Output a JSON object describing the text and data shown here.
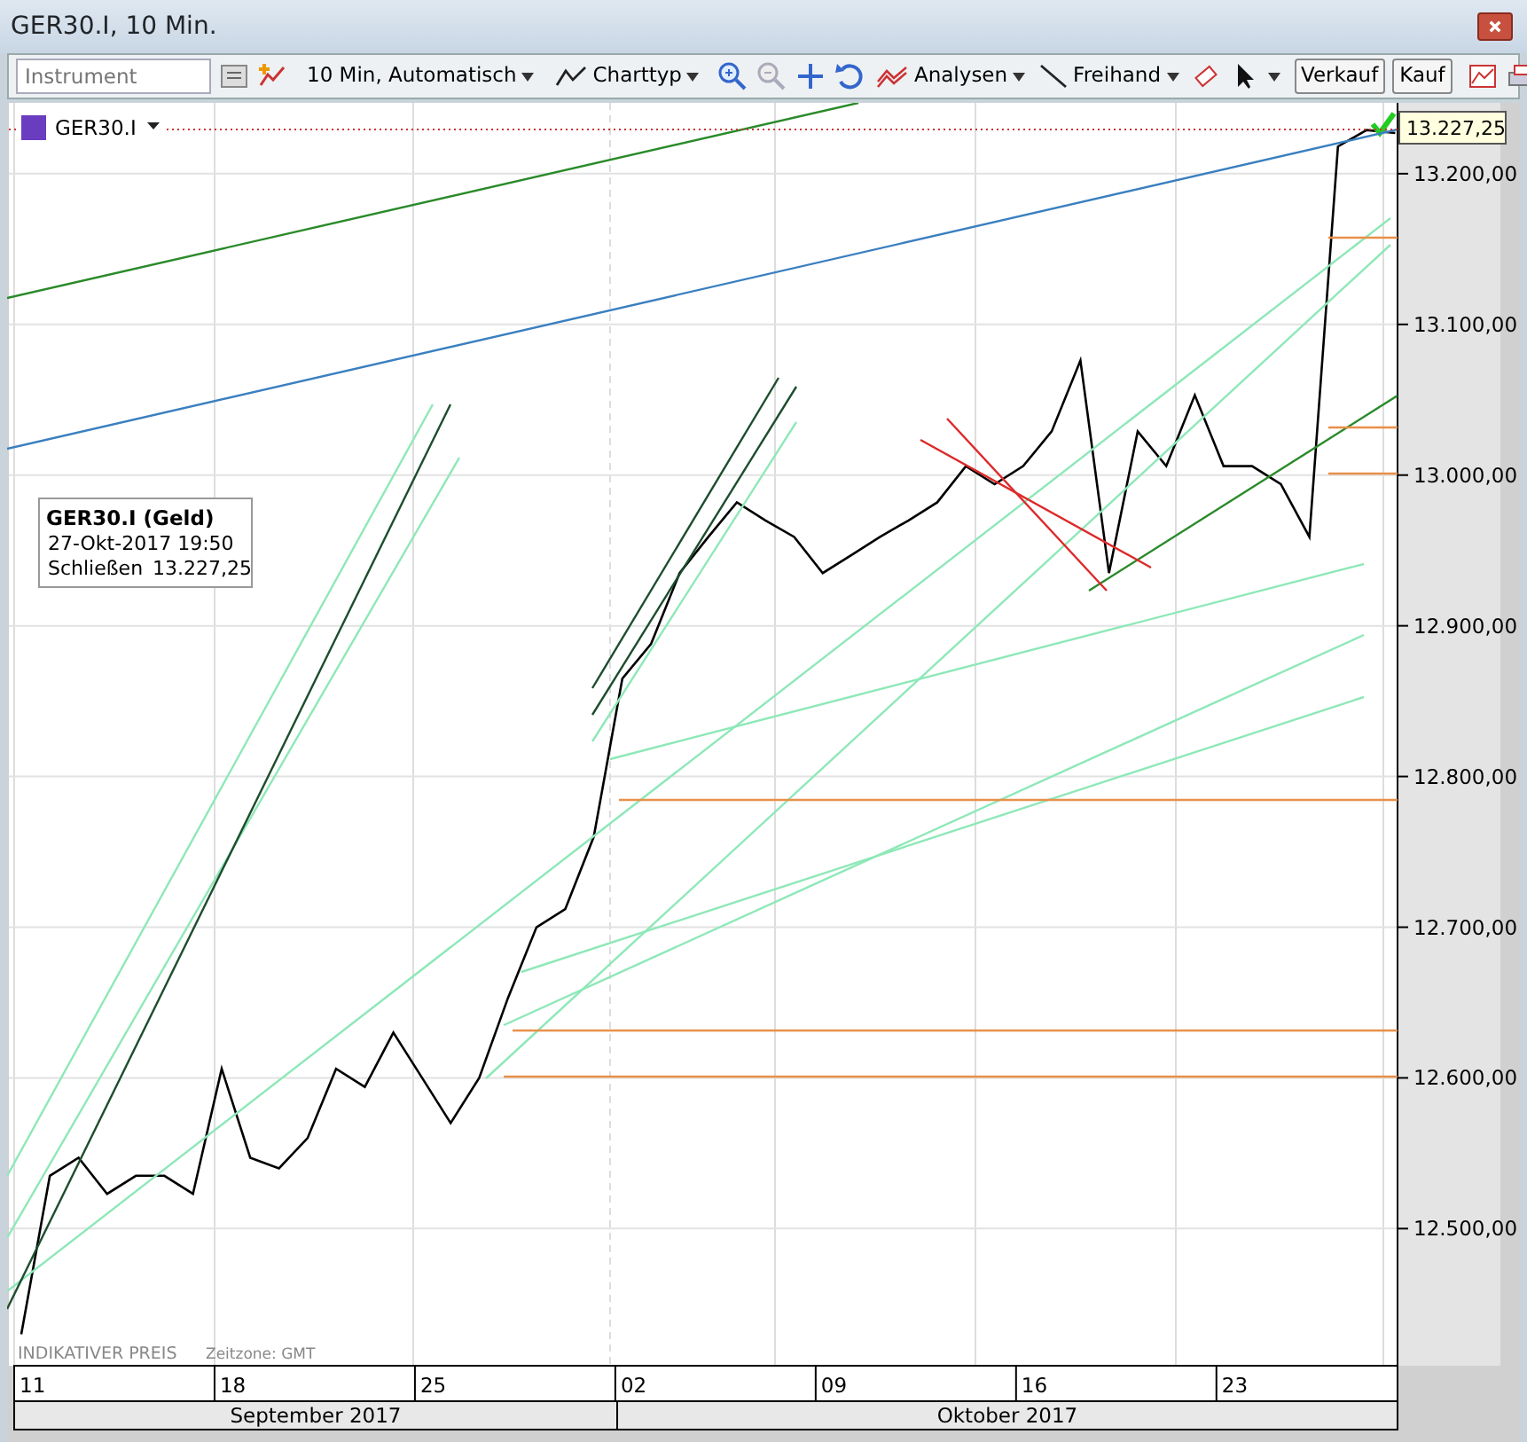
{
  "window": {
    "title": "GER30.I, 10 Min."
  },
  "toolbar": {
    "instrument": {
      "placeholder": "Instrument"
    },
    "interval": "10 Min,  Automatisch",
    "charttyp": "Charttyp",
    "analysen": "Analysen",
    "freihand": "Freihand",
    "buttons": [
      "Verkauf",
      "Kauf"
    ]
  },
  "chart": {
    "info": {
      "title": "GER30.I (Geld)",
      "datetime": "27-Okt-2017 19:50",
      "label": "Schließen",
      "value": "13.227,25"
    },
    "price_tag": "13.227,25",
    "chart_data": {
      "type": "line",
      "categories": [
        "11",
        null,
        null,
        null,
        null,
        null,
        null,
        "18",
        null,
        null,
        null,
        null,
        null,
        null,
        "25",
        null,
        null,
        null,
        null,
        null,
        null,
        "02",
        null,
        null,
        null,
        null,
        null,
        null,
        "09",
        null,
        null,
        null,
        null,
        null,
        null,
        "16",
        null,
        null,
        null,
        null,
        null,
        null,
        "23",
        null,
        null,
        null,
        null,
        null,
        null
      ],
      "ylim": [
        12409,
        13247
      ],
      "grid": true,
      "series": [
        {
          "name": "GER30.I",
          "color": "#000000",
          "values": [
            12430,
            12535,
            12547,
            12523,
            12535,
            12535,
            12523,
            12606,
            12547,
            12540,
            12560,
            12606,
            12594,
            12630,
            12600,
            12570,
            12600,
            12653,
            12700,
            12712,
            12760,
            12865,
            12888,
            12935,
            12959,
            12982,
            12970,
            12959,
            12935,
            12947,
            12959,
            12970,
            12982,
            13006,
            12994,
            13006,
            13029,
            13076,
            12935,
            13029,
            13006,
            13053,
            13006,
            13006,
            12994,
            12959,
            13218,
            13229,
            13227
          ]
        }
      ],
      "yticks": [
        {
          "value": 13200,
          "label": "13.200,00"
        },
        {
          "value": 13100,
          "label": "13.100,00"
        },
        {
          "value": 13000,
          "label": "13.000,00"
        },
        {
          "value": 12900,
          "label": "12.900,00"
        },
        {
          "value": 12800,
          "label": "12.800,00"
        },
        {
          "value": 12700,
          "label": "12.700,00"
        },
        {
          "value": 12600,
          "label": "12.600,00"
        },
        {
          "value": 12500,
          "label": "12.500,00"
        }
      ]
    },
    "footer": {
      "left": "INDIKATIVER PREIS",
      "right": "Zeitzone: GMT"
    },
    "months": [
      "September 2017",
      "Oktober 2017"
    ]
  }
}
